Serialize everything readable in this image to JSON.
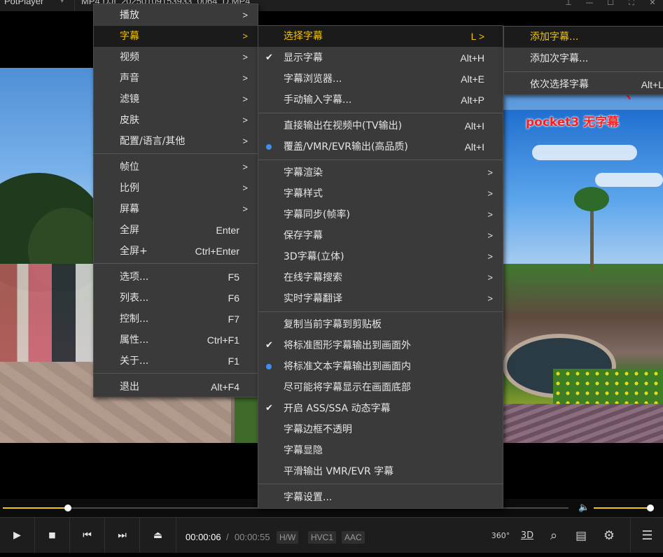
{
  "titlebar": {
    "app_name": "PotPlayer",
    "file_name": "MP4  DJI_20250109153933_0064_D.MP4",
    "caret": "▾",
    "window_buttons": [
      "⊥",
      "—",
      "☐",
      "⛶",
      "✕"
    ]
  },
  "note": {
    "text": "pocket3 无字幕",
    "color": "#ff1e1e"
  },
  "main_menu": [
    {
      "label": "播放",
      "arrow": ">"
    },
    {
      "label": "字幕",
      "arrow": ">",
      "highlight": true
    },
    {
      "label": "视频",
      "arrow": ">"
    },
    {
      "label": "声音",
      "arrow": ">"
    },
    {
      "label": "滤镜",
      "arrow": ">"
    },
    {
      "label": "皮肤",
      "arrow": ">"
    },
    {
      "label": "配置/语言/其他",
      "arrow": ">"
    },
    {
      "label": "帧位",
      "arrow": ">"
    },
    {
      "label": "比例",
      "arrow": ">"
    },
    {
      "label": "屏幕",
      "arrow": ">"
    },
    {
      "label": "全屏",
      "shortcut": "Enter"
    },
    {
      "label": "全屏+",
      "shortcut": "Ctrl+Enter"
    },
    {
      "label": "选项...",
      "shortcut": "F5"
    },
    {
      "label": "列表...",
      "shortcut": "F6"
    },
    {
      "label": "控制...",
      "shortcut": "F7"
    },
    {
      "label": "属性...",
      "shortcut": "Ctrl+F1"
    },
    {
      "label": "关于...",
      "shortcut": "F1"
    },
    {
      "label": "退出",
      "shortcut": "Alt+F4"
    }
  ],
  "subtitle_menu": [
    {
      "label": "选择字幕",
      "shortcut": "L >",
      "highlight": true
    },
    {
      "label": "显示字幕",
      "shortcut": "Alt+H",
      "mark": "check"
    },
    {
      "label": "字幕浏览器...",
      "shortcut": "Alt+E"
    },
    {
      "label": "手动输入字幕...",
      "shortcut": "Alt+P"
    },
    {
      "label": "直接输出在视频中(TV输出)",
      "shortcut": "Alt+I"
    },
    {
      "label": "覆盖/VMR/EVR输出(高品质)",
      "shortcut": "Alt+I",
      "mark": "radio"
    },
    {
      "label": "字幕渲染",
      "arrow": ">"
    },
    {
      "label": "字幕样式",
      "arrow": ">"
    },
    {
      "label": "字幕同步(帧率)",
      "arrow": ">"
    },
    {
      "label": "保存字幕",
      "arrow": ">"
    },
    {
      "label": "3D字幕(立体)",
      "arrow": ">"
    },
    {
      "label": "在线字幕搜索",
      "arrow": ">"
    },
    {
      "label": "实时字幕翻译",
      "arrow": ">"
    },
    {
      "label": "复制当前字幕到剪贴板"
    },
    {
      "label": "将标准图形字幕输出到画面外",
      "mark": "check"
    },
    {
      "label": "将标准文本字幕输出到画面内",
      "mark": "radio"
    },
    {
      "label": "尽可能将字幕显示在画面底部"
    },
    {
      "label": "开启 ASS/SSA 动态字幕",
      "mark": "check"
    },
    {
      "label": "字幕边框不透明"
    },
    {
      "label": "字幕显隐"
    },
    {
      "label": "平滑输出 VMR/EVR 字幕"
    },
    {
      "label": "字幕设置..."
    }
  ],
  "select_subtitle_menu": [
    {
      "label": "添加字幕...",
      "highlight": true
    },
    {
      "label": "添加次字幕..."
    },
    {
      "label": "依次选择字幕",
      "shortcut": "Alt+L"
    }
  ],
  "playback": {
    "current_time": "00:00:06",
    "separator": "/",
    "total_time": "00:00:55",
    "progress_fraction": 0.115,
    "volume_fraction": 0.95,
    "badges": [
      "H/W",
      "HVC1",
      "AAC"
    ]
  },
  "controls": {
    "play": "▶",
    "stop": "■",
    "prev": "⏮",
    "next": "⏭",
    "eject": "⏏",
    "icon_360": "360°",
    "icon_3d": "3D",
    "icon_search": "⌕",
    "icon_list": "▤",
    "icon_gear": "⚙",
    "icon_menu": "☰",
    "volume_icon": "🔈"
  },
  "colors": {
    "accent": "#f0c400",
    "menu_bg": "#3a3a3a",
    "radio": "#3f8ff2",
    "annotation": "#ff1e1e"
  }
}
